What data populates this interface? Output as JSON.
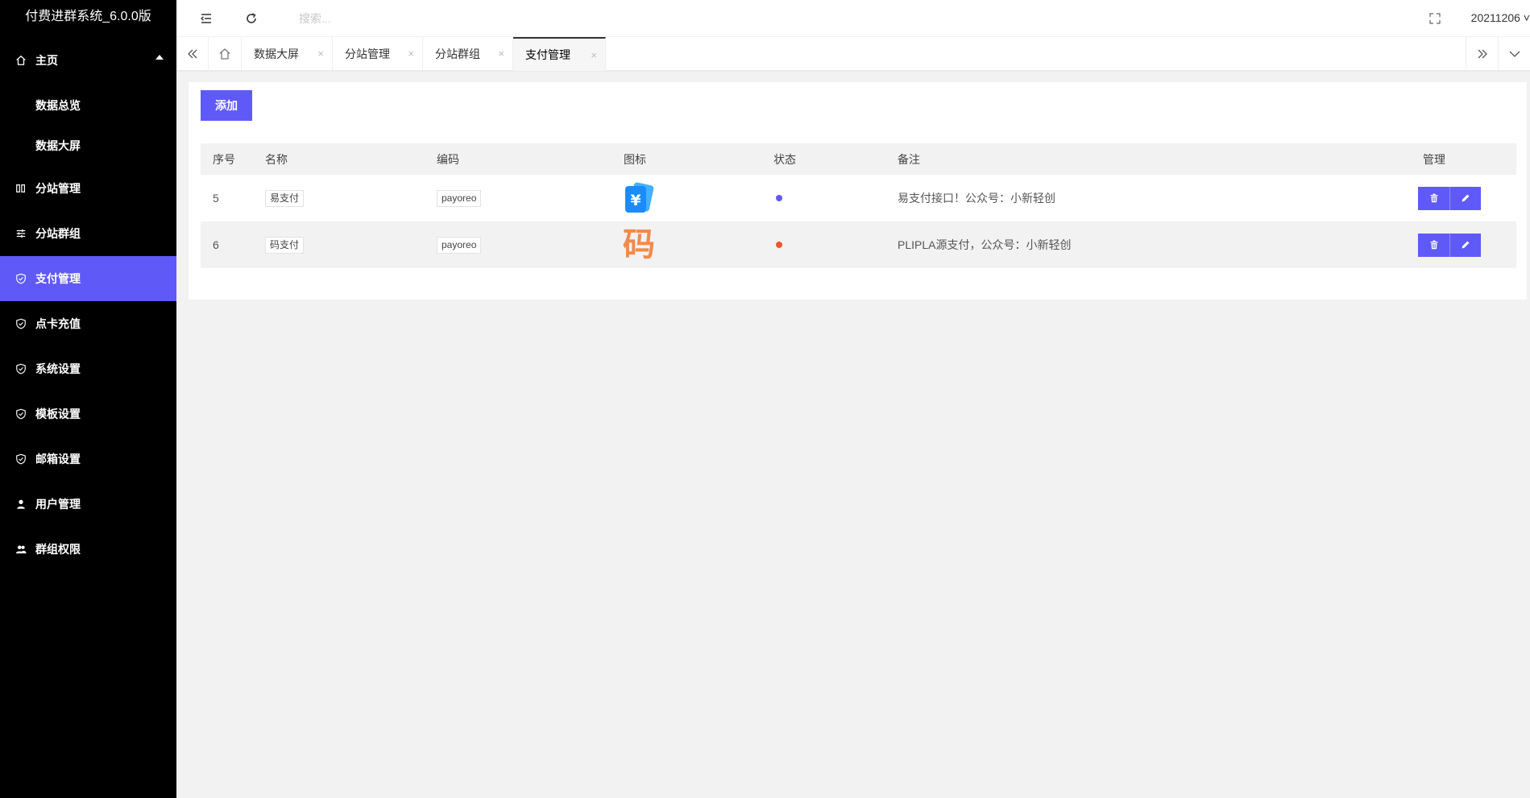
{
  "app": {
    "title": "付费进群系统_6.0.0版"
  },
  "sidebar": {
    "home": {
      "label": "主页",
      "icon": "home-icon"
    },
    "sub_items": [
      {
        "label": "数据总览"
      },
      {
        "label": "数据大屏"
      }
    ],
    "items": [
      {
        "label": "分站管理",
        "icon": "columns-icon"
      },
      {
        "label": "分站群组",
        "icon": "sliders-icon"
      },
      {
        "label": "支付管理",
        "icon": "shield-icon",
        "active": true
      },
      {
        "label": "点卡充值",
        "icon": "shield-icon"
      },
      {
        "label": "系统设置",
        "icon": "shield-icon"
      },
      {
        "label": "模板设置",
        "icon": "shield-icon"
      },
      {
        "label": "邮箱设置",
        "icon": "shield-icon"
      },
      {
        "label": "用户管理",
        "icon": "user-icon"
      },
      {
        "label": "群组权限",
        "icon": "users-icon"
      }
    ],
    "active_color": "#5f5af7"
  },
  "header": {
    "search_placeholder": "搜索...",
    "user": "20211206 ˅"
  },
  "tabs": [
    {
      "label": "数据大屏"
    },
    {
      "label": "分站管理"
    },
    {
      "label": "分站群组"
    },
    {
      "label": "支付管理",
      "active": true
    }
  ],
  "content": {
    "add_button": "添加",
    "table": {
      "headers": [
        "序号",
        "名称",
        "编码",
        "图标",
        "状态",
        "备注",
        "管理"
      ],
      "rows": [
        {
          "id": "5",
          "name": "易支付",
          "code": "payoreo",
          "icon": "wallet-yuan-icon",
          "status_color": "#5f5af7",
          "remark": "易支付接口！公众号：小新轻创"
        },
        {
          "id": "6",
          "name": "码支付",
          "code": "payoreo",
          "icon": "ma-icon",
          "icon_text": "码",
          "status_color": "#f0552f",
          "remark": "PLIPLA源支付，公众号：小新轻创"
        }
      ]
    }
  }
}
